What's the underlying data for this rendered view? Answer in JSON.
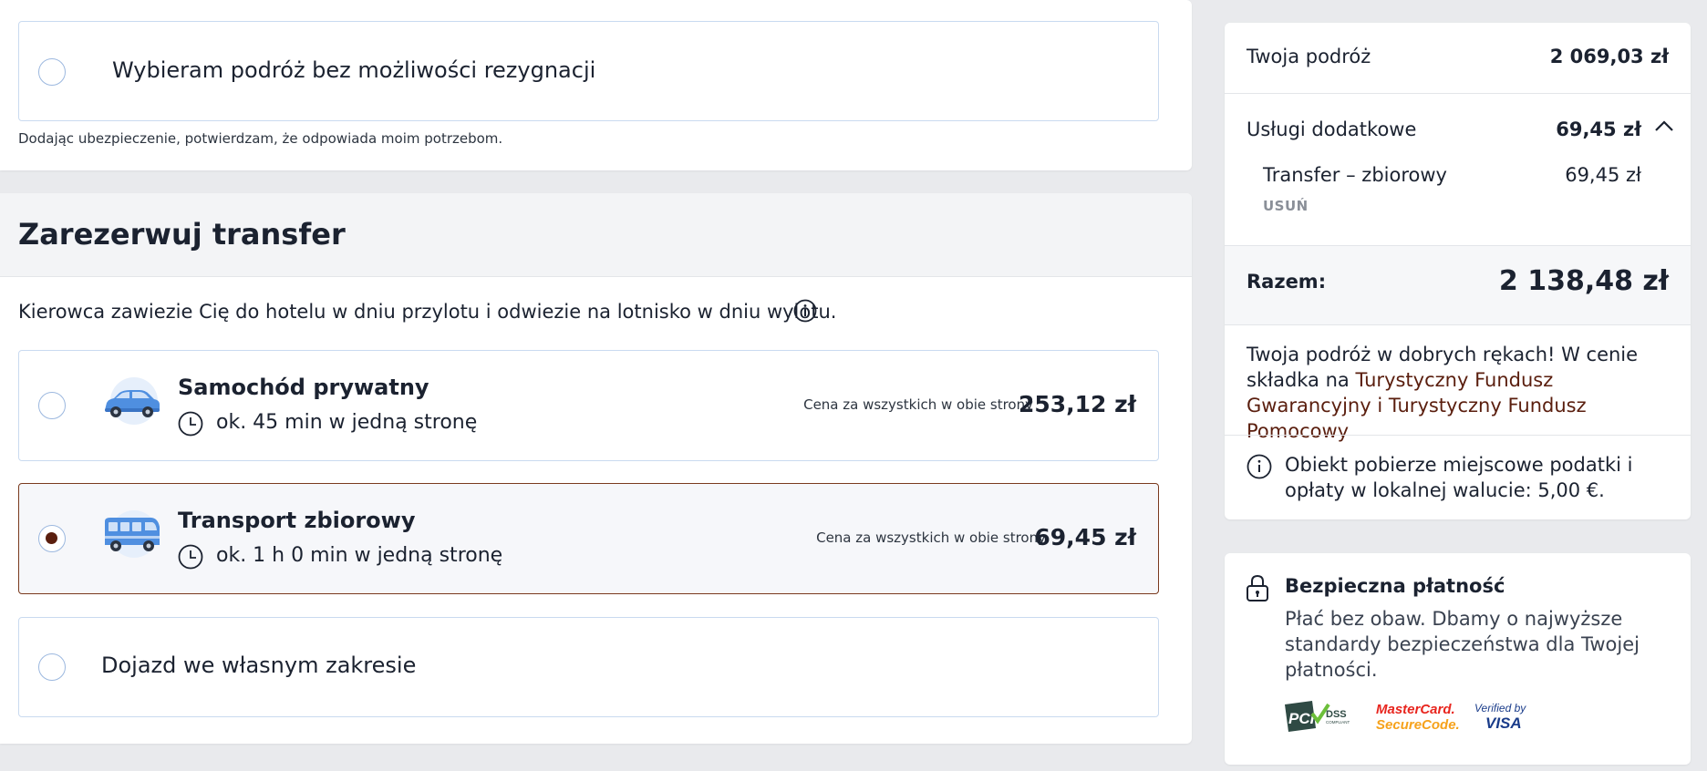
{
  "insurance": {
    "no_cancel_label": "Wybieram podróż bez możliwości rezygnacji",
    "disclaimer": "Dodając ubezpieczenie, potwierdzam, że odpowiada moim potrzebom."
  },
  "transfer": {
    "title": "Zarezerwuj transfer",
    "description": "Kierowca zawiezie Cię do hotelu w dniu przylotu i odwiezie na lotnisko w dniu wylotu.",
    "options": [
      {
        "title": "Samochód prywatny",
        "duration": "ok. 45 min w jedną stronę",
        "price_note": "Cena za wszystkich w obie strony",
        "price": "253,12 zł",
        "icon": "car-icon",
        "selected": false
      },
      {
        "title": "Transport zbiorowy",
        "duration": "ok. 1 h 0 min w jedną stronę",
        "price_note": "Cena za wszystkich w obie strony",
        "price": "69,45 zł",
        "icon": "bus-icon",
        "selected": true
      }
    ],
    "own_label": "Dojazd we własnym zakresie"
  },
  "summary": {
    "trip_label": "Twoja podróż",
    "trip_price": "2 069,03 zł",
    "extras_label": "Usługi dodatkowe",
    "extras_price": "69,45 zł",
    "extra_item_label": "Transfer – zbiorowy",
    "extra_item_price": "69,45 zł",
    "remove_label": "USUŃ",
    "total_label": "Razem:",
    "total_value": "2 138,48 zł",
    "guarantee_text": "Twoja podróż w dobrych rękach! W cenie składka na",
    "guarantee_link": "Turystyczny Fundusz Gwarancyjny i Turystyczny Fundusz Pomocowy",
    "tax_text": "Obiekt pobierze miejscowe podatki i opłaty w lokalnej walucie: 5,00 €."
  },
  "secure": {
    "title": "Bezpieczna płatność",
    "text": "Płać bez obaw. Dbamy o najwyższe standardy bezpieczeństwa dla Twojej płatności.",
    "logos": {
      "pci_mark": "PCI",
      "pci_dss": "DSS",
      "pci_compliant": "COMPLIANT",
      "mastercard_line1": "MasterCard.",
      "mastercard_line2": "SecureCode.",
      "visa_verified": "Verified by",
      "visa": "VISA"
    }
  },
  "colors": {
    "accent": "#5a1e0e",
    "radio_border": "#9cb8df",
    "box_border": "#c9daf0"
  }
}
